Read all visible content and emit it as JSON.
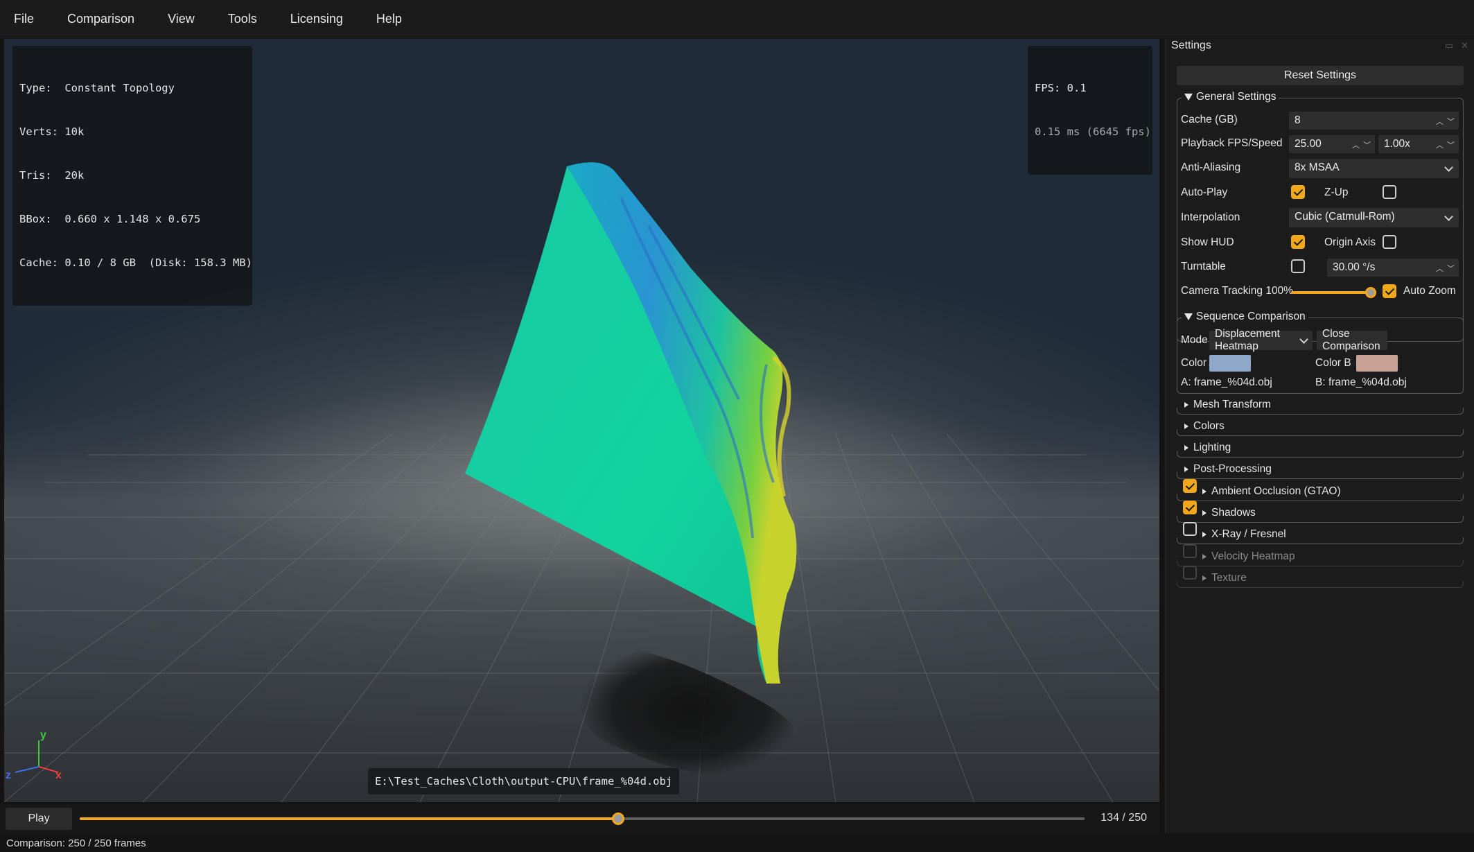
{
  "menu": [
    "File",
    "Comparison",
    "View",
    "Tools",
    "Licensing",
    "Help"
  ],
  "hud": {
    "lines": [
      "Type:  Constant Topology",
      "Verts: 10k",
      "Tris:  20k",
      "BBox:  0.660 x 1.148 x 0.675",
      "Cache: 0.10 / 8 GB  (Disk: 158.3 MB)"
    ],
    "fps": "FPS: 0.1",
    "frame_time": "0.15 ms (6645 fps)"
  },
  "viewport": {
    "file_path": "E:\\Test_Caches\\Cloth\\output-CPU\\frame_%04d.obj",
    "axis": {
      "y": "y",
      "z": "z",
      "x": "x"
    }
  },
  "timeline": {
    "play_label": "Play",
    "frame_counter": "134 / 250",
    "current_frame": 134,
    "total_frames": 250
  },
  "status": "Comparison: 250 / 250 frames",
  "settings": {
    "title": "Settings",
    "reset_label": "Reset Settings",
    "general": {
      "title": "General Settings",
      "cache_label": "Cache (GB)",
      "cache_value": "8",
      "playback_label": "Playback FPS/Speed",
      "fps_value": "25.00",
      "speed_value": "1.00x",
      "aa_label": "Anti-Aliasing",
      "aa_value": "8x MSAA",
      "autoplay_label": "Auto-Play",
      "autoplay_checked": true,
      "zup_label": "Z-Up",
      "zup_checked": false,
      "interp_label": "Interpolation",
      "interp_value": "Cubic (Catmull-Rom)",
      "hud_label": "Show HUD",
      "hud_checked": true,
      "origin_label": "Origin Axis",
      "origin_checked": false,
      "turntable_label": "Turntable",
      "turntable_checked": false,
      "turntable_value": "30.00 °/s",
      "tracking_label": "Camera Tracking 100%",
      "tracking_value": 1.0,
      "autozoom_label": "Auto Zoom",
      "autozoom_checked": true
    },
    "comparison": {
      "title": "Sequence Comparison",
      "mode_label": "Mode",
      "mode_value": "Displacement Heatmap",
      "close_label": "Close Comparison",
      "color_a_label": "Color A",
      "color_a": "#8fa7c9",
      "color_b_label": "Color B",
      "color_b": "#c9a296",
      "file_a": "A: frame_%04d.obj",
      "file_b": "B: frame_%04d.obj"
    },
    "sections": {
      "mesh_transform": "Mesh Transform",
      "colors": "Colors",
      "lighting": "Lighting",
      "post_processing": "Post-Processing",
      "ao": "Ambient Occlusion (GTAO)",
      "shadows": "Shadows",
      "xray": "X-Ray / Fresnel",
      "velocity": "Velocity Heatmap",
      "texture": "Texture"
    }
  },
  "colors": {
    "accent": "#f2a81a"
  }
}
